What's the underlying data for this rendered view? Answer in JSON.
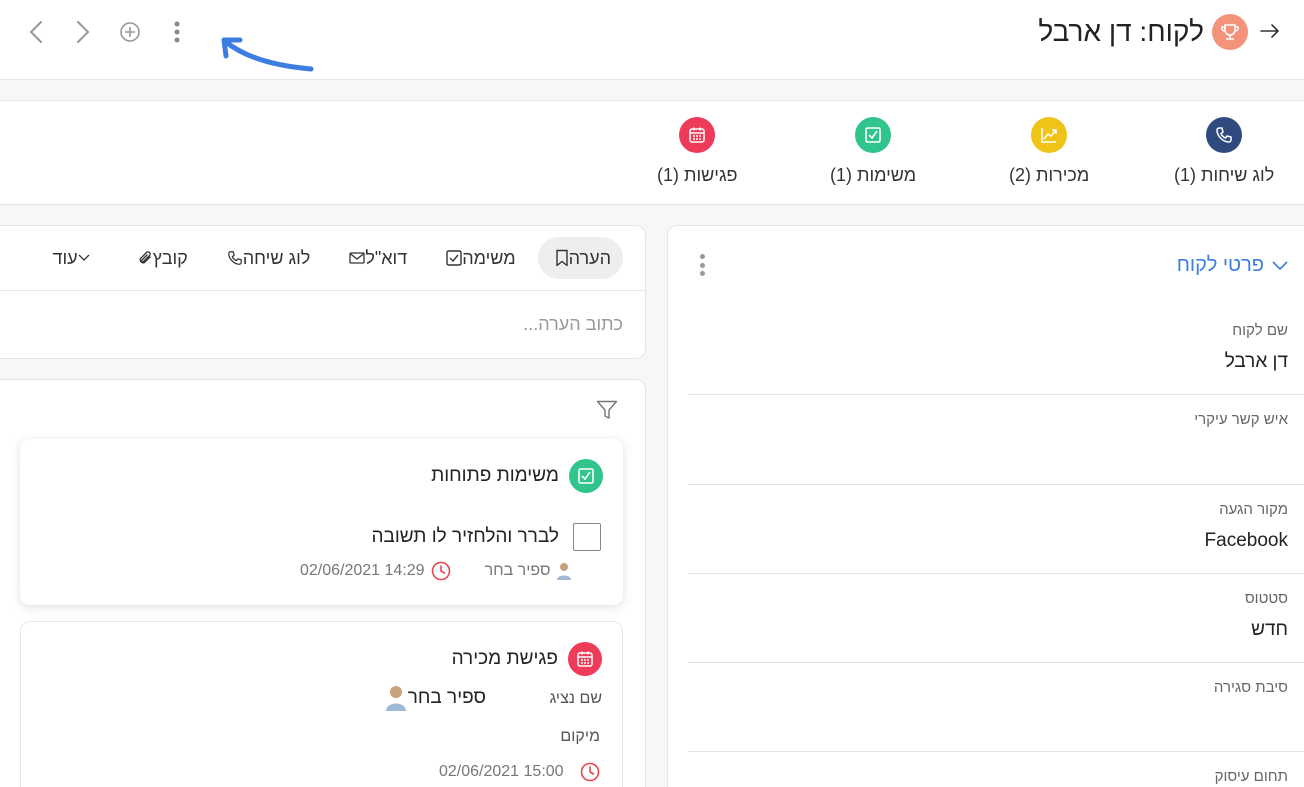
{
  "header": {
    "title": "לקוח: דן ארבל",
    "title_icon": "trophy-icon",
    "back_icon": "arrow-right-icon",
    "nav_icons": [
      "chevron-left-icon",
      "chevron-right-icon",
      "plus-circle-icon",
      "kebab-menu-icon"
    ]
  },
  "tabs": [
    {
      "label": "לוג שיחות (1)",
      "icon": "phone-icon",
      "color": "#2f4a7e"
    },
    {
      "label": "מכירות (2)",
      "icon": "trend-chart-icon",
      "color": "#f0c417"
    },
    {
      "label": "משימות (1)",
      "icon": "checkbox-icon",
      "color": "#31c48d"
    },
    {
      "label": "פגישות (1)",
      "icon": "calendar-icon",
      "color": "#ef3b5a"
    }
  ],
  "composer": {
    "tabs": [
      {
        "label": "הערה",
        "icon": "bookmark-icon"
      },
      {
        "label": "משימה",
        "icon": "checkbox-icon"
      },
      {
        "label": "דוא\"ל",
        "icon": "envelope-icon"
      },
      {
        "label": "לוג שיחה",
        "icon": "phone-icon"
      },
      {
        "label": "קובץ",
        "icon": "paperclip-icon"
      },
      {
        "label": "עוד",
        "icon": "chevron-down-icon"
      }
    ],
    "placeholder": "כתוב הערה..."
  },
  "feed": {
    "open_tasks": {
      "title": "משימות פתוחות",
      "task": "לברר והלחזיר לו תשובה",
      "assignee": "ספיר בחר",
      "datetime": "02/06/2021 14:29"
    },
    "meeting": {
      "title": "פגישת מכירה",
      "rep_label": "שם נציג",
      "rep_name": "ספיר בחר",
      "location_label": "מיקום",
      "datetime": "02/06/2021 15:00"
    }
  },
  "details": {
    "title": "פרטי לקוח",
    "fields": [
      {
        "label": "שם לקוח",
        "value": "דן ארבל"
      },
      {
        "label": "איש קשר עיקרי",
        "value": ""
      },
      {
        "label": "מקור הגעה",
        "value": "Facebook"
      },
      {
        "label": "סטטוס",
        "value": "חדש"
      },
      {
        "label": "סיבת סגירה",
        "value": ""
      },
      {
        "label": "תחום עיסוק",
        "value": ""
      }
    ]
  },
  "colors": {
    "accent_blue": "#3b7de0",
    "trophy": "#f5937a",
    "clock_red": "#e8474f",
    "annotation_arrow": "#3b7de0"
  }
}
